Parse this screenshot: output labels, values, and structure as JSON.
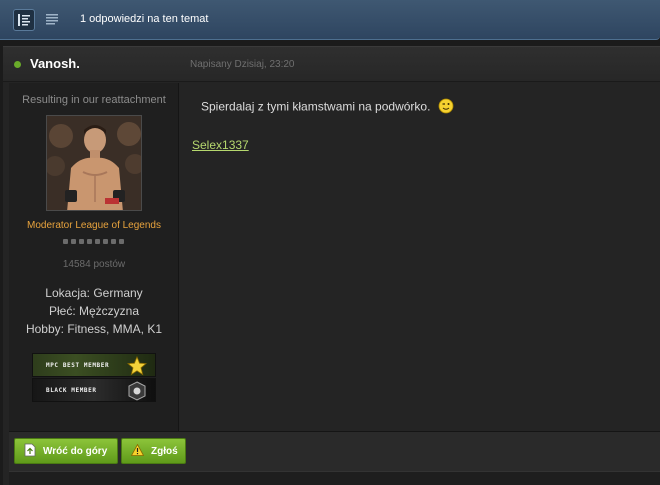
{
  "topic_bar": {
    "replies_label": "1 odpowiedzi na ten temat",
    "view_modes": [
      "threaded-view-icon",
      "list-view-icon"
    ]
  },
  "post": {
    "author": {
      "name": "Vanosh.",
      "online": true,
      "user_title": "Resulting in our reattachment",
      "group": "Moderator League of Legends",
      "rank_pips": 8,
      "post_count": "14584 postów",
      "fields": [
        "Lokacja: Germany",
        "Płeć: Mężczyzna",
        "Hobby: Fitness, MMA, K1"
      ],
      "awards": [
        {
          "label": "MPC BEST MEMBER",
          "icon": "star-icon"
        },
        {
          "label": "BLACK MEMBER",
          "icon": "emblem-icon"
        }
      ]
    },
    "date": "Napisany Dzisiaj, 23:20",
    "body_text": "Spierdalaj z tymi kłamstwami na podwórko.",
    "body_smiley": "wink-smiley-icon",
    "signature_link": "Selex1337",
    "footer": {
      "back_to_top": "Wróć do góry",
      "report": "Zgłoś"
    }
  },
  "colors": {
    "accent_green": "#7bb52e",
    "group_orange": "#e8a33d",
    "link_green": "#b6d86e",
    "header_blue": "#3f5872"
  }
}
